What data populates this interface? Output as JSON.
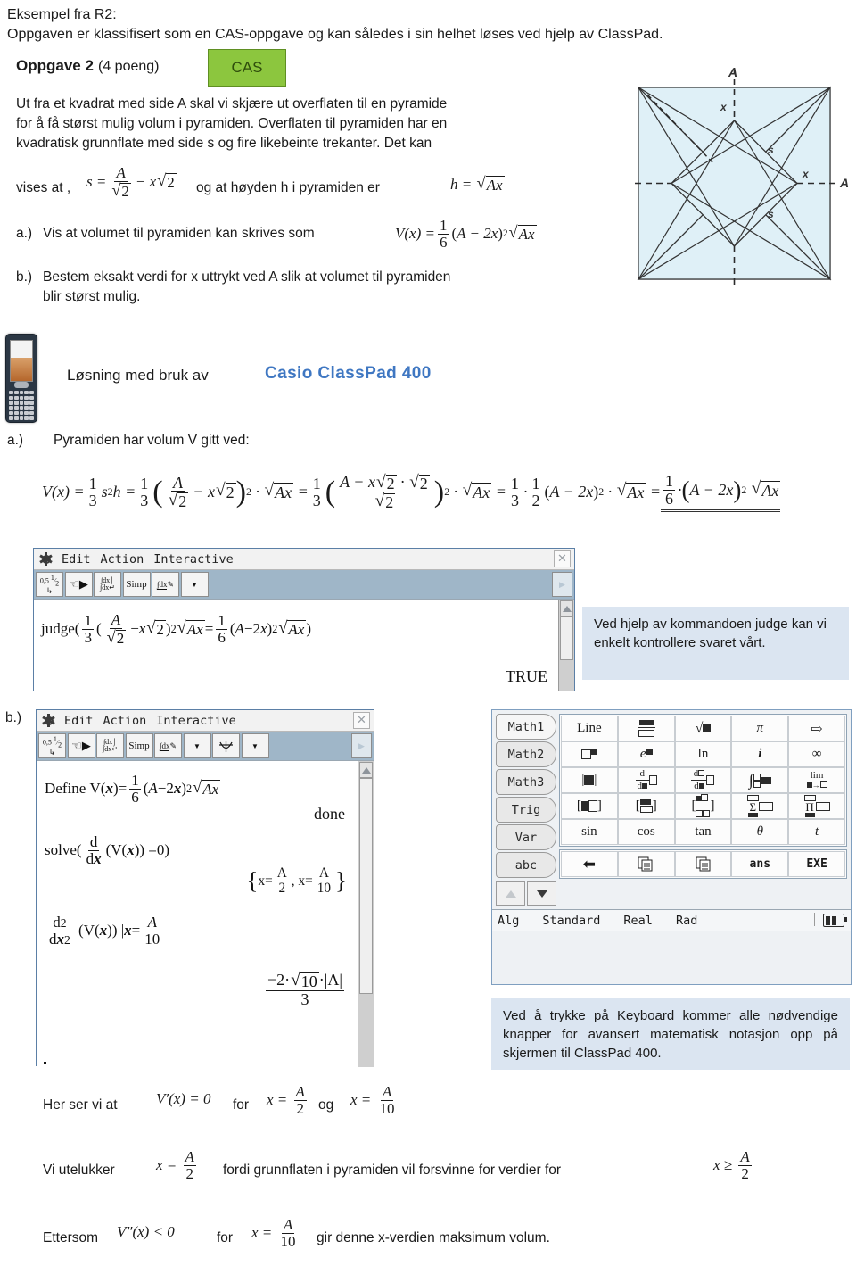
{
  "header": {
    "line1": "Eksempel fra R2:",
    "line2": "Oppgaven er klassifisert som en CAS-oppgave og kan således i sin helhet løses ved hjelp av ClassPad."
  },
  "task": {
    "title": "Oppgave 2",
    "points": "(4 poeng)",
    "badge": "CAS",
    "body_lines": [
      "Ut fra et kvadrat med side A skal vi skjære ut overflaten til en pyramide",
      "for å få størst mulig volum i pyramiden. Overflaten til pyramiden har en",
      "kvadratisk grunnflate med side s og fire likebeinte trekanter. Det kan"
    ],
    "vises_at": "vises at ,",
    "og_at": "og at høyden h i pyramiden er",
    "a_label": "a.)",
    "a_text": "Vis at volumet til pyramiden kan skrives som",
    "b_label": "b.)",
    "b_text_line1": "Bestem eksakt verdi for x uttrykt ved A slik at volumet til pyramiden",
    "b_text_line2": "blir størst mulig."
  },
  "figure": {
    "label_top": "A",
    "label_right": "A",
    "label_x_top": "x",
    "label_x_right": "x",
    "label_s_upper": "s",
    "label_s_lower": "s",
    "fill_color": "#dff0f7",
    "stroke_color": "#333333"
  },
  "solution": {
    "intro_prefix": "Løsning med bruk av",
    "intro_brand": "Casio ClassPad 400",
    "brand_color": "#3f77c2",
    "a_label": "a.)",
    "a_text": "Pyramiden har volum V gitt ved:",
    "b_label": "b.)"
  },
  "classpad_a": {
    "menu": {
      "edit": "Edit",
      "action": "Action",
      "interactive": "Interactive",
      "close": "✕"
    },
    "toolbar_buttons": [
      "0,5 1/2",
      "hand",
      "∫dx",
      "Simp",
      "∫dx-pen",
      "▼"
    ],
    "entry": "judge( 1/3 ( A/√2 − x√2 )² √(Ax) = 1/6 (A−2x)² √(Ax) )",
    "result": "TRUE"
  },
  "classpad_b": {
    "menu": {
      "edit": "Edit",
      "action": "Action",
      "interactive": "Interactive",
      "close": "✕"
    },
    "toolbar_buttons": [
      "0,5 1/2",
      "hand",
      "∫dx",
      "Simp",
      "∫dx-pen",
      "▼",
      "graph",
      "▼"
    ],
    "line_define": "Define V(x)= 1/6 (A−2x)² √(Ax)",
    "result_done": "done",
    "line_solve": "solve( d/dx (V(x)) =0)",
    "result_solutions": "{ x=A/2 , x=A/10 }",
    "line_second": "d²/dx² (V(x)) |x=A/10",
    "result_second": "−2·√10·|A| / 3"
  },
  "keyboard": {
    "tabs": [
      "Math1",
      "Math2",
      "Math3",
      "Trig",
      "Var",
      "abc"
    ],
    "rows": [
      [
        "Line",
        "fraction",
        "sqrt",
        "π",
        "⇒"
      ],
      [
        "power",
        "e-power",
        "ln",
        "i",
        "∞"
      ],
      [
        "abs",
        "d/d▪",
        "d▫/d▪",
        "integral",
        "lim"
      ],
      [
        "[▪▫]",
        "[matrix2]",
        "[matrix4]",
        "Σ",
        "Π"
      ],
      [
        "sin",
        "cos",
        "tan",
        "θ",
        "t"
      ],
      [
        "⬅",
        "copy",
        "paste",
        "ans",
        "EXE"
      ]
    ],
    "status": [
      "Alg",
      "Standard",
      "Real",
      "Rad"
    ]
  },
  "notes": {
    "judge": "Ved hjelp av kommandoen judge kan vi enkelt kontrollere svaret vårt.",
    "keyboard": "Ved å trykke på Keyboard kommer alle nødvendige knapper for avansert matematisk notasjon opp på skjermen til ClassPad 400."
  },
  "conclusion": {
    "line1_a": "Her ser vi at",
    "line1_b": "for",
    "line1_c": "og",
    "line2_a": "Vi utelukker",
    "line2_b": "fordi grunnflaten i pyramiden vil forsvinne for verdier for",
    "line3_a": "Ettersom",
    "line3_b": "for",
    "line3_c": "gir denne x-verdien maksimum volum."
  }
}
